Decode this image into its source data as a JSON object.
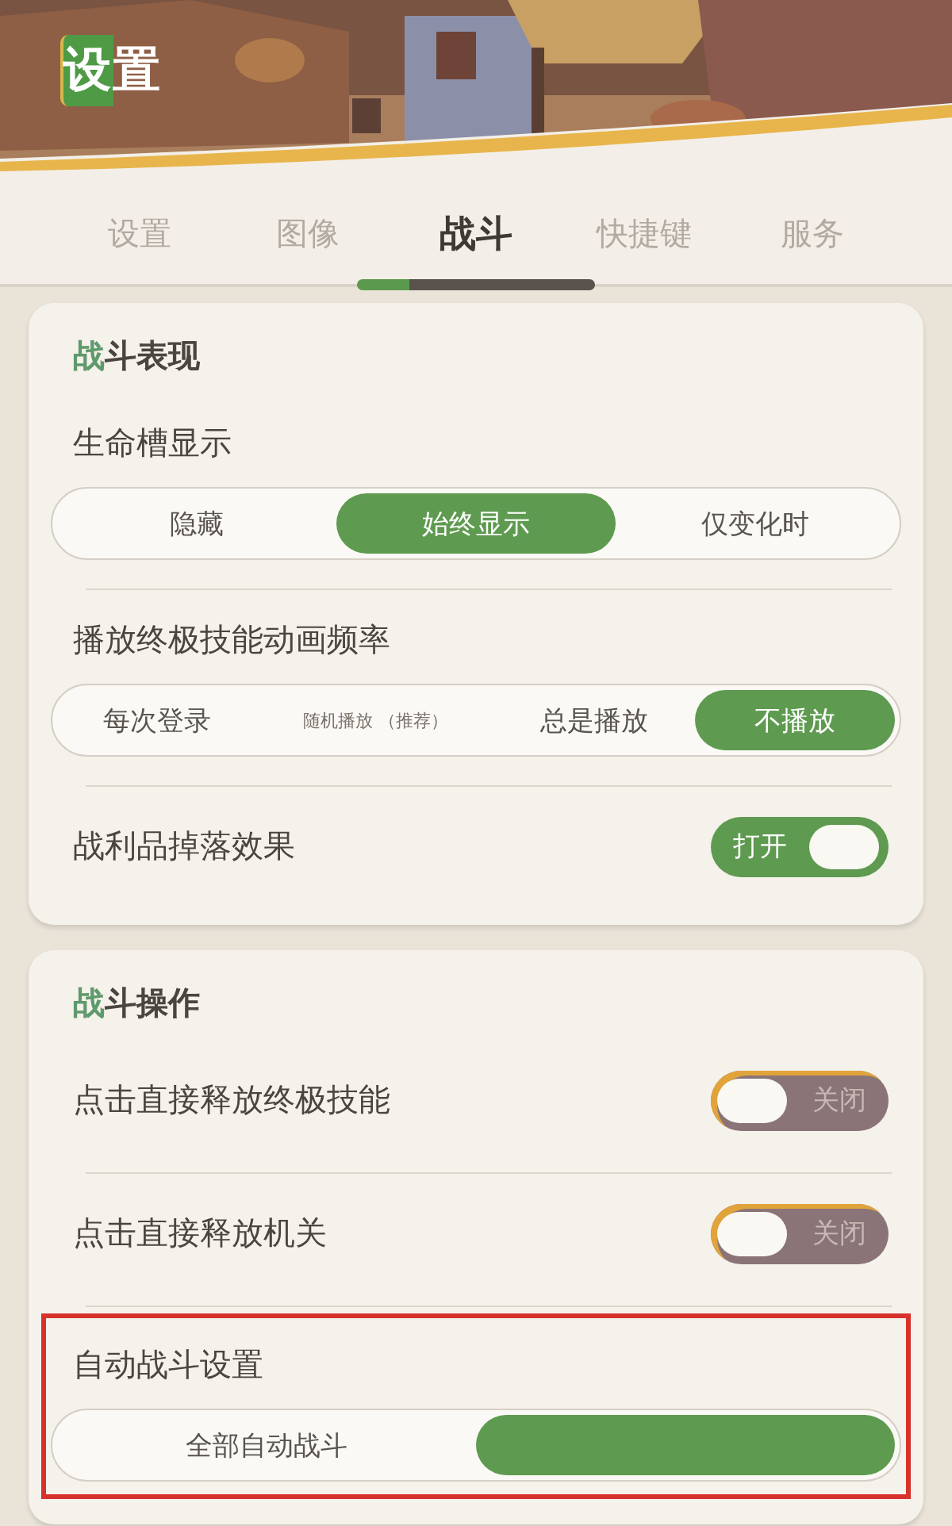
{
  "header": {
    "kind": "picture",
    "title": "设置"
  },
  "tabs": [
    {
      "label": "设置",
      "selected": false
    },
    {
      "label": "图像",
      "selected": false
    },
    {
      "label": "战斗",
      "selected": true
    },
    {
      "label": "快捷键",
      "selected": false
    },
    {
      "label": "服务",
      "selected": false
    }
  ],
  "sections": [
    {
      "title": "战斗表现",
      "rows": [
        {
          "kind": "segmented",
          "label": "生命槽显示",
          "highlighted": false,
          "options": [
            {
              "label": "隐藏",
              "selected": false,
              "small": false
            },
            {
              "label": "始终显示",
              "selected": true,
              "small": false
            },
            {
              "label": "仅变化时",
              "selected": false,
              "small": false
            }
          ]
        },
        {
          "kind": "segmented",
          "label": "播放终极技能动画频率",
          "highlighted": false,
          "options": [
            {
              "label": "每次登录",
              "selected": false,
              "small": false
            },
            {
              "label": "随机播放 （推荐）",
              "selected": false,
              "small": true
            },
            {
              "label": "总是播放",
              "selected": false,
              "small": false
            },
            {
              "label": "不播放",
              "selected": true,
              "small": false
            }
          ]
        },
        {
          "kind": "toggle",
          "label": "战利品掉落效果",
          "highlighted": false,
          "on": true,
          "state_text": "打开"
        }
      ]
    },
    {
      "title": "战斗操作",
      "rows": [
        {
          "kind": "toggle",
          "label": "点击直接释放终极技能",
          "highlighted": false,
          "on": false,
          "state_text": "关闭"
        },
        {
          "kind": "toggle",
          "label": "点击直接释放机关",
          "highlighted": false,
          "on": false,
          "state_text": "关闭"
        },
        {
          "kind": "segmented",
          "label": "自动战斗设置",
          "highlighted": true,
          "options": [
            {
              "label": "全部自动战斗",
              "selected": false,
              "small": false
            },
            {
              "selected": true,
              "small": false
            }
          ]
        }
      ]
    }
  ]
}
